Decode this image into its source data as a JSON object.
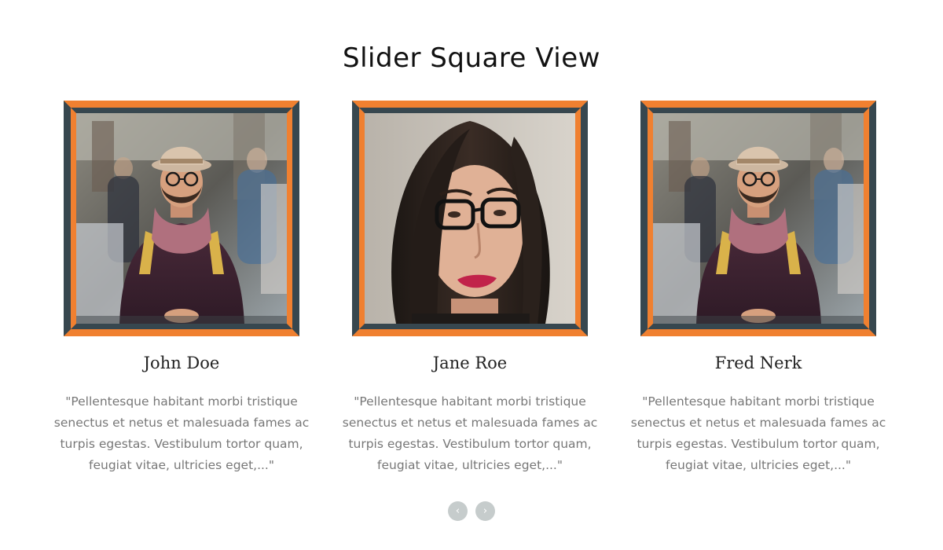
{
  "header": {
    "title": "Slider Square View"
  },
  "colors": {
    "frame_accent": "#f08030",
    "frame_dark": "#37474f",
    "nav_button": "#c6cccc"
  },
  "cards": [
    {
      "name": "John Doe",
      "quote": "\"Pellentesque habitant morbi tristique senectus et netus et malesuada fames ac turpis egestas. Vestibulum tortor quam, feugiat vitae, ultricies eget,...\"",
      "photo": "man-with-hat-glasses-scarf-photo"
    },
    {
      "name": "Jane Roe",
      "quote": "\"Pellentesque habitant morbi tristique senectus et netus et malesuada fames ac turpis egestas. Vestibulum tortor quam, feugiat vitae, ultricies eget,...\"",
      "photo": "woman-with-glasses-photo"
    },
    {
      "name": "Fred Nerk",
      "quote": "\"Pellentesque habitant morbi tristique senectus et netus et malesuada fames ac turpis egestas. Vestibulum tortor quam, feugiat vitae, ultricies eget,...\"",
      "photo": "man-with-hat-glasses-scarf-photo"
    }
  ],
  "nav": {
    "prev_icon": "‹",
    "next_icon": "›"
  }
}
